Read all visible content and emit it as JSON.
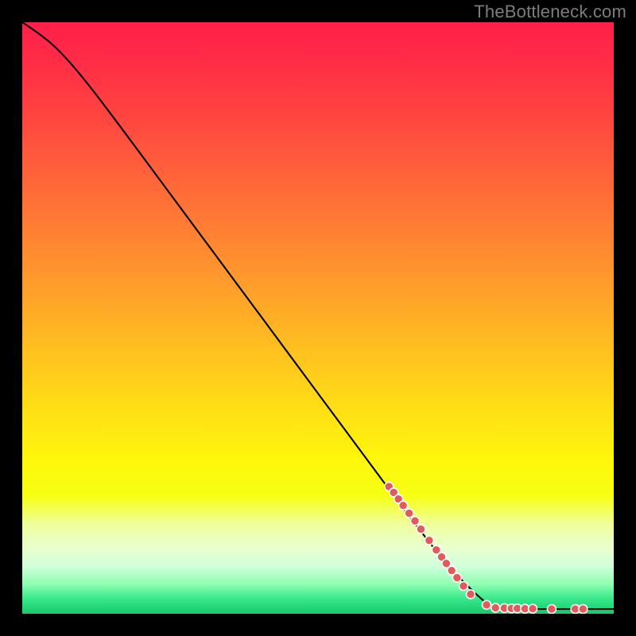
{
  "watermark": "TheBottleneck.com",
  "colors": {
    "dot_fill": "#e35a5a",
    "dot_stroke": "#ffffff",
    "curve": "#000000",
    "gradient_top": "#ff1f4a",
    "gradient_bottom": "#17c86e",
    "background": "#000000",
    "watermark_text": "#7d7d7d"
  },
  "chart_data": {
    "type": "line",
    "title": "",
    "xlabel": "",
    "ylabel": "",
    "xlim": [
      0,
      100
    ],
    "ylim": [
      0,
      100
    ],
    "curve": [
      {
        "x": 0,
        "y": 100
      },
      {
        "x": 3,
        "y": 98
      },
      {
        "x": 6,
        "y": 95.5
      },
      {
        "x": 10,
        "y": 91
      },
      {
        "x": 15,
        "y": 84.5
      },
      {
        "x": 25,
        "y": 71
      },
      {
        "x": 35,
        "y": 57.5
      },
      {
        "x": 45,
        "y": 44
      },
      {
        "x": 55,
        "y": 30.5
      },
      {
        "x": 65,
        "y": 17
      },
      {
        "x": 72,
        "y": 8
      },
      {
        "x": 78,
        "y": 2
      },
      {
        "x": 80,
        "y": 1
      },
      {
        "x": 85,
        "y": 0.8
      },
      {
        "x": 90,
        "y": 0.8
      },
      {
        "x": 95,
        "y": 0.8
      },
      {
        "x": 100,
        "y": 0.8
      }
    ],
    "dots": [
      {
        "x": 62.0,
        "y": 21.5
      },
      {
        "x": 62.8,
        "y": 20.5
      },
      {
        "x": 63.6,
        "y": 19.4
      },
      {
        "x": 64.4,
        "y": 18.3
      },
      {
        "x": 65.4,
        "y": 17.0
      },
      {
        "x": 66.4,
        "y": 15.7
      },
      {
        "x": 67.4,
        "y": 14.3
      },
      {
        "x": 68.8,
        "y": 12.4
      },
      {
        "x": 70.0,
        "y": 10.8
      },
      {
        "x": 70.9,
        "y": 9.6
      },
      {
        "x": 71.7,
        "y": 8.5
      },
      {
        "x": 72.6,
        "y": 7.3
      },
      {
        "x": 73.5,
        "y": 6.1
      },
      {
        "x": 74.6,
        "y": 4.7
      },
      {
        "x": 75.8,
        "y": 3.3
      },
      {
        "x": 78.5,
        "y": 1.5
      },
      {
        "x": 80.0,
        "y": 1.0
      },
      {
        "x": 81.5,
        "y": 0.95
      },
      {
        "x": 82.7,
        "y": 0.9
      },
      {
        "x": 83.7,
        "y": 0.9
      },
      {
        "x": 85.0,
        "y": 0.85
      },
      {
        "x": 86.3,
        "y": 0.85
      },
      {
        "x": 89.5,
        "y": 0.8
      },
      {
        "x": 93.5,
        "y": 0.8
      },
      {
        "x": 94.8,
        "y": 0.8
      }
    ],
    "dot_radius": 5.5
  }
}
